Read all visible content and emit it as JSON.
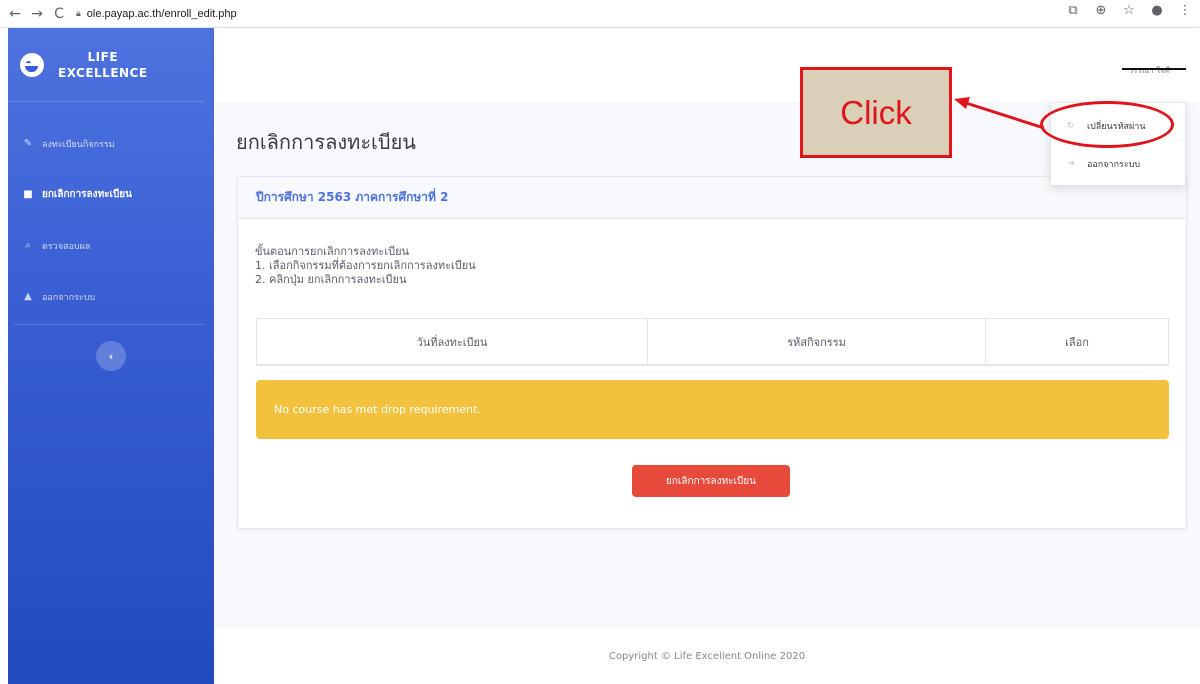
{
  "browser": {
    "url": "ole.payap.ac.th/enroll_edit.php"
  },
  "sidebar": {
    "brand_line1": "LIFE",
    "brand_line2": "EXCELLENCE",
    "items": [
      {
        "label": "ลงทะเบียนกิจกรรม",
        "icon": "pencil-icon",
        "active": false
      },
      {
        "label": "ยกเลิกการลงทะเบียน",
        "icon": "trash-icon",
        "active": true
      },
      {
        "label": "ตรวจสอบผล",
        "icon": "search-icon",
        "active": false
      },
      {
        "label": "ออกจากระบบ",
        "icon": "lock-icon",
        "active": false
      }
    ],
    "toggle_label": "‹"
  },
  "topbar": {
    "user_name": "วรรณา ใจดี"
  },
  "dropdown": {
    "items": [
      {
        "label": "เปลี่ยนรหัสผ่าน",
        "icon": "refresh-icon"
      },
      {
        "label": "ออกจากระบบ",
        "icon": "signout-icon"
      }
    ]
  },
  "main": {
    "page_title": "ยกเลิกการลงทะเบียน",
    "card_header": "ปีการศึกษา 2563 ภาคการศึกษาที่ 2",
    "steps": [
      "ขั้นตอนการยกเลิกการลงทะเบียน",
      "1. เลือกกิจกรรมที่ต้องการยกเลิกการลงทะเบียน",
      "2. คลิกปุ่ม ยกเลิกการลงทะเบียน"
    ],
    "table_headers": [
      "วันที่ลงทะเบียน",
      "รหัสกิจกรรม",
      "เลือก"
    ],
    "alert_text": "No course has met drop requirement.",
    "drop_button": "ยกเลิกการลงทะเบียน"
  },
  "footer": {
    "copyright": "Copyright © Life Excellent Online 2020"
  },
  "annotation": {
    "label": "Click"
  },
  "colors": {
    "primary": "#4e73df",
    "warning": "#f2c23e",
    "danger": "#e74a3b",
    "annotation_red": "#e0141a"
  }
}
